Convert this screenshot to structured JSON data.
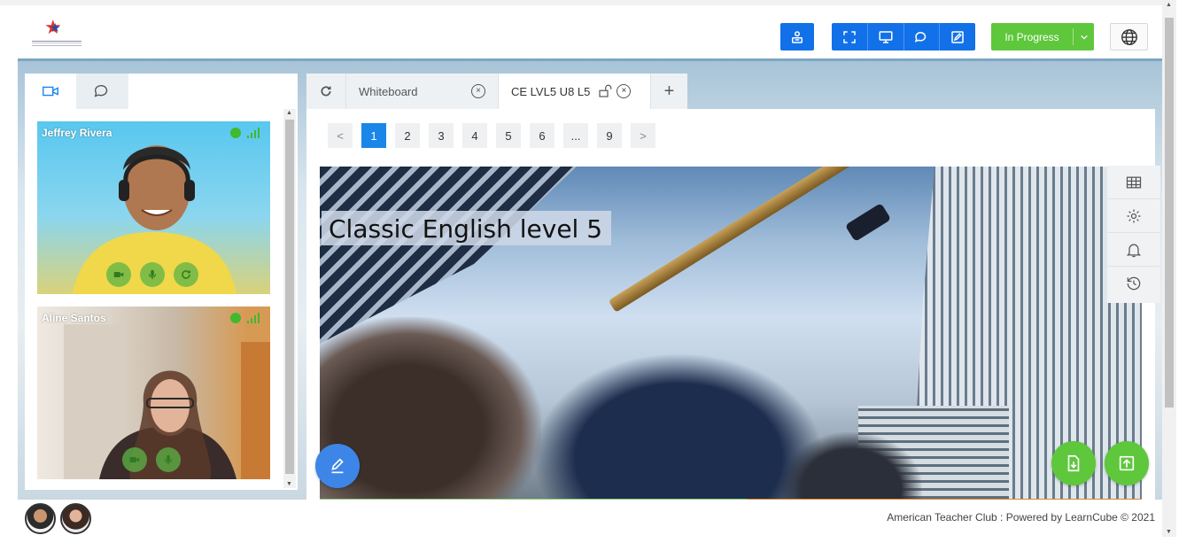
{
  "header": {
    "logo_alt": "American Teacher Club",
    "status_label": "In Progress",
    "toolbar_icons": [
      "dashboard-icon",
      "fullscreen-icon",
      "screen-share-icon",
      "chat-icon",
      "edit-icon"
    ],
    "globe_icon": "globe-icon"
  },
  "left_panel": {
    "tabs": [
      {
        "icon": "video-camera-icon",
        "active": true
      },
      {
        "icon": "chat-icon",
        "active": false
      }
    ],
    "participants": [
      {
        "name": "Jeffrey Rivera",
        "status_color": "#42b82e",
        "controls": [
          "camera-icon",
          "microphone-icon",
          "refresh-icon"
        ]
      },
      {
        "name": "Aline Santos",
        "status_color": "#42b82e",
        "controls": [
          "camera-icon",
          "microphone-icon"
        ]
      }
    ]
  },
  "main": {
    "tabs": [
      {
        "label": "Whiteboard",
        "active": false
      },
      {
        "label": "CE LVL5 U8 L5",
        "active": true
      }
    ],
    "add_tab_label": "+",
    "pager": {
      "prev": "<",
      "pages": [
        "1",
        "2",
        "3",
        "4",
        "5",
        "6",
        "...",
        "9"
      ],
      "current": "1",
      "next": ">"
    },
    "slide": {
      "title": "Classic English level 5"
    },
    "side_tools": [
      "grid-icon",
      "settings-icon",
      "bell-icon",
      "history-icon"
    ]
  },
  "footer": {
    "credit": "American Teacher Club : Powered by  LearnCube © 2021"
  },
  "colors": {
    "primary_blue": "#1271e8",
    "status_green": "#5ec73b",
    "active_page": "#1a86e8"
  }
}
